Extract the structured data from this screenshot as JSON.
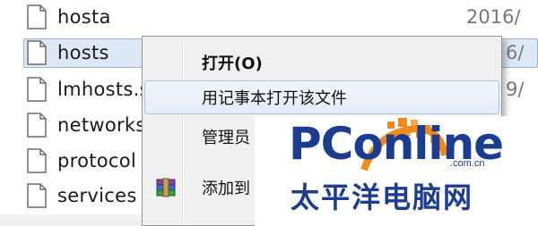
{
  "file_list": {
    "rows": [
      {
        "name": "hosta",
        "date": "2016/"
      },
      {
        "name": "hosts",
        "date": "6/",
        "selected": true
      },
      {
        "name": "lmhosts.s",
        "date": "9/"
      },
      {
        "name": "networks",
        "date": ""
      },
      {
        "name": "protocol",
        "date": ""
      },
      {
        "name": "services",
        "date": ""
      }
    ]
  },
  "context_menu": {
    "items": [
      {
        "label": "打开(O)",
        "bold": true
      },
      {
        "label": "用记事本打开该文件",
        "hover": true
      },
      {
        "label": "管理员"
      },
      {
        "label": "",
        "spacer": true
      },
      {
        "label": "添加到",
        "icon": "winrar-icon"
      }
    ]
  },
  "watermark": {
    "wordmark": "PConline",
    "domain": ".com.cn",
    "chinese": "太平洋电脑网",
    "brand_color": "#1b3c8f",
    "accent_color": "#f08a1c"
  },
  "colors": {
    "selection_bg": "#dde8f5",
    "menu_bg": "#f0f0f0"
  }
}
